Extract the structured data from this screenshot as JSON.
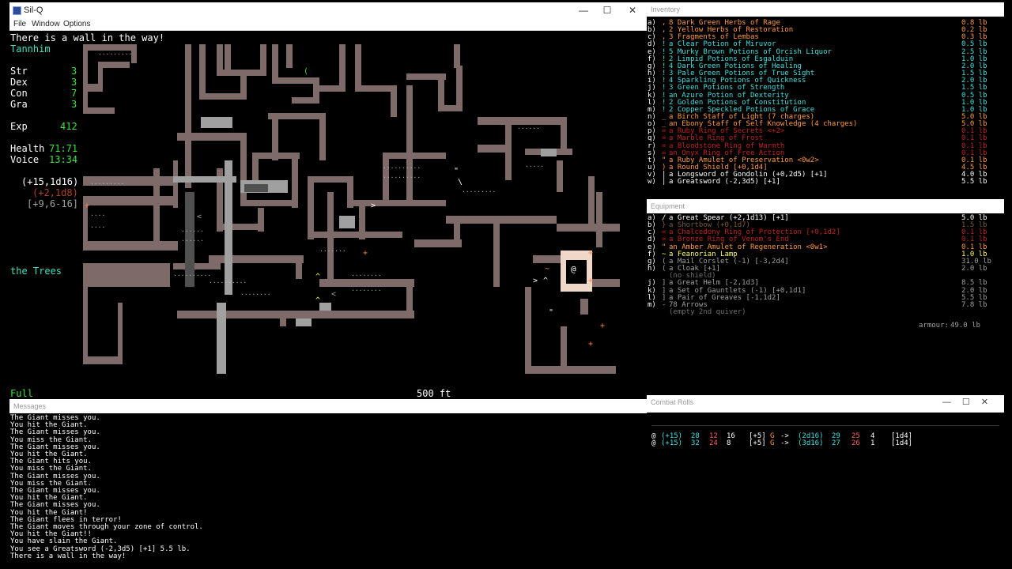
{
  "window": {
    "title": "Sil-Q",
    "menu": [
      "File",
      "Window",
      "Options"
    ],
    "controls": [
      "—",
      "☐",
      "✕"
    ]
  },
  "game": {
    "top_message": "There is a wall in the way!",
    "character": "Tannhim",
    "stats": [
      {
        "name": "Str",
        "value": "3"
      },
      {
        "name": "Dex",
        "value": "3"
      },
      {
        "name": "Con",
        "value": "7"
      },
      {
        "name": "Gra",
        "value": "3"
      }
    ],
    "exp": {
      "label": "Exp",
      "value": "412"
    },
    "health": {
      "label": "Health",
      "value": "71:71"
    },
    "voice": {
      "label": "Voice",
      "value": "13:34"
    },
    "melee": "(+15,1d16)",
    "ranged": "(+2,1d8)",
    "defense": "[+9,6-16]",
    "location": "the Trees",
    "status": "Full",
    "depth": "500 ft",
    "player_glyph": "@"
  },
  "inventory": {
    "panel_title": "Inventory",
    "items": [
      {
        "letter": "a)",
        "sym": ",",
        "name": "8 Dark Green Herbs of Rage",
        "weight": "0.8 lb",
        "color": "#ff9a40"
      },
      {
        "letter": "b)",
        "sym": ",",
        "name": "2 Yellow Herbs of Restoration",
        "weight": "0.2 lb",
        "color": "#ff9a40"
      },
      {
        "letter": "c)",
        "sym": ",",
        "name": "3 Fragments of Lembas",
        "weight": "0.3 lb",
        "color": "#ff9a40"
      },
      {
        "letter": "d)",
        "sym": "!",
        "name": "a Clear Potion of Miruvor",
        "weight": "0.5 lb",
        "color": "#40e0e0"
      },
      {
        "letter": "e)",
        "sym": "!",
        "name": "5 Murky Brown Potions of Orcish Liquor",
        "weight": "2.5 lb",
        "color": "#40e0e0"
      },
      {
        "letter": "f)",
        "sym": "!",
        "name": "2 Limpid Potions of Esgalduin",
        "weight": "1.0 lb",
        "color": "#40e0e0"
      },
      {
        "letter": "g)",
        "sym": "!",
        "name": "4 Dark Green Potions of Healing",
        "weight": "2.0 lb",
        "color": "#40e0e0"
      },
      {
        "letter": "h)",
        "sym": "!",
        "name": "3 Pale Green Potions of True Sight",
        "weight": "1.5 lb",
        "color": "#40e0e0"
      },
      {
        "letter": "i)",
        "sym": "!",
        "name": "4 Sparkling Potions of Quickness",
        "weight": "2.0 lb",
        "color": "#40e0e0"
      },
      {
        "letter": "j)",
        "sym": "!",
        "name": "3 Green Potions of Strength",
        "weight": "1.5 lb",
        "color": "#40e0e0"
      },
      {
        "letter": "k)",
        "sym": "!",
        "name": "an Azure Potion of Dexterity",
        "weight": "0.5 lb",
        "color": "#40e0e0"
      },
      {
        "letter": "l)",
        "sym": "!",
        "name": "2 Golden Potions of Constitution",
        "weight": "1.0 lb",
        "color": "#40e0e0"
      },
      {
        "letter": "m)",
        "sym": "!",
        "name": "2 Copper Speckled Potions of Grace",
        "weight": "1.0 lb",
        "color": "#40e0e0"
      },
      {
        "letter": "n)",
        "sym": "_",
        "name": "a Birch Staff of Light (7 charges)",
        "weight": "5.0 lb",
        "color": "#ff9a40"
      },
      {
        "letter": "o)",
        "sym": "_",
        "name": "an Ebony Staff of Self Knowledge (4 charges)",
        "weight": "5.0 lb",
        "color": "#ff9a40"
      },
      {
        "letter": "p)",
        "sym": "=",
        "name": "a Ruby Ring of Secrets <+2>",
        "weight": "0.1 lb",
        "color": "#c02020"
      },
      {
        "letter": "q)",
        "sym": "=",
        "name": "a Marble Ring of Frost",
        "weight": "0.1 lb",
        "color": "#c02020"
      },
      {
        "letter": "r)",
        "sym": "=",
        "name": "a Bloodstone Ring of Warmth",
        "weight": "0.1 lb",
        "color": "#c02020"
      },
      {
        "letter": "s)",
        "sym": "=",
        "name": "an Onyx Ring of Free Action",
        "weight": "0.1 lb",
        "color": "#c02020"
      },
      {
        "letter": "t)",
        "sym": "\"",
        "name": "a Ruby Amulet of Preservation <0w2>",
        "weight": "0.1 lb",
        "color": "#ff9a40"
      },
      {
        "letter": "u)",
        "sym": ")",
        "name": "a Round Shield [+0,1d4]",
        "weight": "4.5 lb",
        "color": "#ff9a40"
      },
      {
        "letter": "v)",
        "sym": "|",
        "name": "a Longsword of Gondolin (+0,2d5) [+1]",
        "weight": "4.0 lb",
        "color": "#ffffff"
      },
      {
        "letter": "w)",
        "sym": "|",
        "name": "a Greatsword (-2,3d5) [+1]",
        "weight": "5.5 lb",
        "color": "#ffffff"
      }
    ]
  },
  "equipment": {
    "panel_title": "Equipment",
    "items": [
      {
        "letter": "a)",
        "sym": "/",
        "name": "a Great Spear (+2,1d13) [+1]",
        "weight": "5.0 lb",
        "color": "#ffffff"
      },
      {
        "letter": "b)",
        "sym": "}",
        "name": "a Shortbow (+0,1d7)",
        "weight": "1.5 lb",
        "color": "#7a5a3a"
      },
      {
        "letter": "c)",
        "sym": "=",
        "name": "a Chalcedony Ring of Protection [+0,1d2]",
        "weight": "0.1 lb",
        "color": "#c02020"
      },
      {
        "letter": "d)",
        "sym": "=",
        "name": "a Bronze Ring of Venom's End",
        "weight": "0.1 lb",
        "color": "#c02020"
      },
      {
        "letter": "e)",
        "sym": "\"",
        "name": "an Amber Amulet of Regeneration <0w1>",
        "weight": "0.1 lb",
        "color": "#ff9a40"
      },
      {
        "letter": "f)",
        "sym": "~",
        "name": "a Feanorian Lamp",
        "weight": "1.0 lb",
        "color": "#ffff60"
      },
      {
        "letter": "g)",
        "sym": "(",
        "name": "a Mail Corslet (-1) [-3,2d4]",
        "weight": "31.0 lb",
        "color": "#a0a0a0"
      },
      {
        "letter": "h)",
        "sym": "(",
        "name": "a Cloak [+1]",
        "weight": "2.0 lb",
        "color": "#a0a0a0"
      },
      {
        "letter": "",
        "sym": "",
        "name": "(no shield)",
        "weight": "",
        "color": "#707070"
      },
      {
        "letter": "j)",
        "sym": "]",
        "name": "a Great Helm [-2,1d3]",
        "weight": "8.5 lb",
        "color": "#a0a0a0"
      },
      {
        "letter": "k)",
        "sym": "]",
        "name": "a Set of Gauntlets (-1) [+0,1d1]",
        "weight": "2.0 lb",
        "color": "#a0a0a0"
      },
      {
        "letter": "l)",
        "sym": "]",
        "name": "a Pair of Greaves [-1,1d2]",
        "weight": "5.5 lb",
        "color": "#a0a0a0"
      },
      {
        "letter": "m)",
        "sym": "-",
        "name": "78 Arrows",
        "weight": "7.8 lb",
        "color": "#a0a0a0"
      },
      {
        "letter": "",
        "sym": "",
        "name": "(empty 2nd quiver)",
        "weight": "",
        "color": "#707070"
      }
    ],
    "armour_label": "armour:",
    "armour_value": "49.0 lb"
  },
  "messages": {
    "panel_title": "Messages",
    "lines": [
      "The Giant misses you.",
      "You hit the Giant.",
      "The Giant misses you.",
      "You miss the Giant.",
      "The Giant misses you.",
      "You hit the Giant.",
      "The Giant hits you.",
      "You miss the Giant.",
      "The Giant misses you.",
      "You miss the Giant.",
      "The Giant misses you.",
      "You hit the Giant.",
      "The Giant misses you.",
      "You hit the Giant!",
      "The Giant flees in terror!",
      "The Giant moves through your zone of control.",
      "You hit the Giant!!",
      "You have slain the Giant.",
      "You see a Greatsword (-2,3d5) [+1] 5.5 lb.",
      "There is a wall in the way!"
    ]
  },
  "combat": {
    "panel_title": "Combat Rolls",
    "rows": [
      [
        "@",
        "(+15)",
        "28",
        "12",
        "16",
        "[+5]",
        "G",
        "->",
        "(2d16)",
        "29",
        "25",
        "4",
        "[1d4]"
      ],
      [
        "@",
        "(+15)",
        "32",
        "24",
        "8",
        "[+5]",
        "G",
        "->",
        "(3d16)",
        "27",
        "26",
        "1",
        "[1d4]"
      ]
    ]
  }
}
